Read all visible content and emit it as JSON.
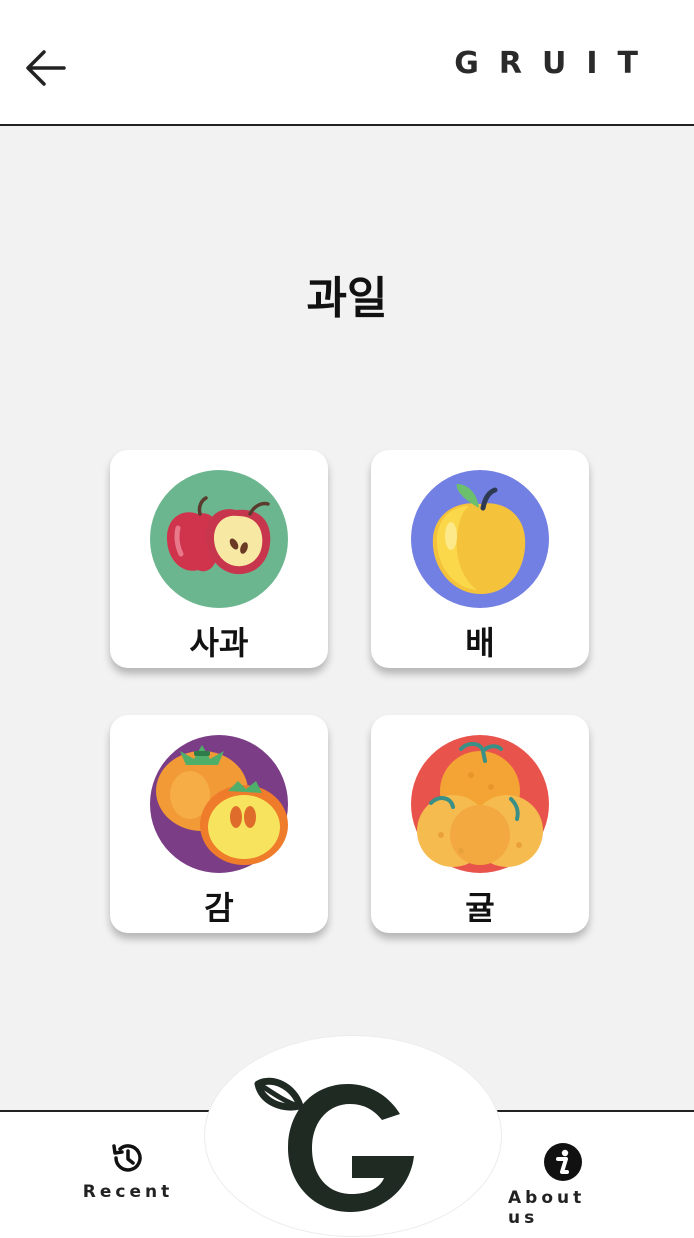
{
  "header": {
    "brand": "GRUIT",
    "back_icon": "arrow-left-icon"
  },
  "page": {
    "title": "과일"
  },
  "fruits": [
    {
      "label": "사과",
      "icon": "apple-icon",
      "bg": "#6cb68f"
    },
    {
      "label": "배",
      "icon": "pear-icon",
      "bg": "#7380e3"
    },
    {
      "label": "감",
      "icon": "persimmon-icon",
      "bg": "#7b3e86"
    },
    {
      "label": "귤",
      "icon": "tangerine-icon",
      "bg": "#e8544b"
    }
  ],
  "bottom_nav": {
    "recent_label": "Recent",
    "recent_icon": "history-icon",
    "logo_icon": "gruit-logo-icon",
    "about_label": "About us",
    "about_icon": "info-icon"
  }
}
